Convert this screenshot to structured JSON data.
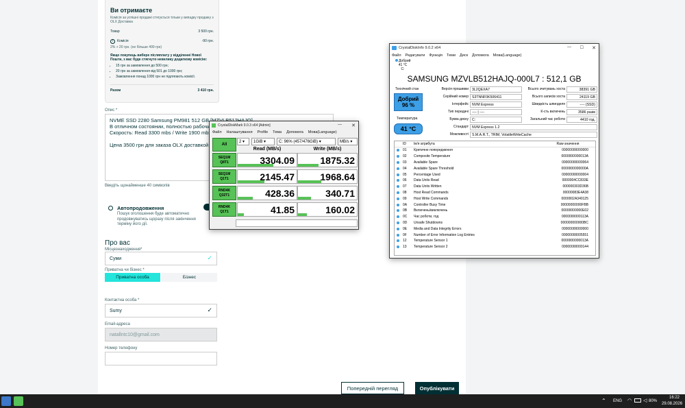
{
  "olx": {
    "card": {
      "title": "Ви отримаєте",
      "note": "Комісія за успішні продажі стягується тільки у випадку продажу з OLX Доставка",
      "goods_label": "Товар",
      "goods_value": "3 500 грн.",
      "commission_label": "Комісія",
      "commission_value": "-90 грн.",
      "commission_sub": "2% + 20 грн. (не більше 499 грн)",
      "extra_note": "Якщо покупець вибере післяплату у відділенні Нової Пошти, з вас буде стягнуто невелику додаткову комісію:",
      "extra_items": [
        "15 грн за замовлення до 500 грн;",
        "20 грн за замовлення від 501 до 1000 грн;",
        "Замовлення понад 1000 грн не підлягають комісії."
      ],
      "total_label": "Разом",
      "total_value": "3 410 грн."
    },
    "description_label": "Опис *",
    "description_text": "NVME SSD  2280 Samsung PM981 512 GB [MZVLB512HAJQ]\nВ отличном состоянии, полностью рабочий, здо...\nСкорость: Read 3300 mbs / Write 1900 mbs\n\nЦена 3500 грн для заказа OLX доставкой, без т...",
    "description_hint": "Введіть щонайменше 40 символів",
    "autorenew_title": "Автопродовження",
    "autorenew_text": "Пошук оголошення буде автоматично продовжуватись щоразу після закінчення терміну його дії.",
    "about_title": "Про вас",
    "location_label": "Місцезнаходження*",
    "location_value": "Суми",
    "person_type_label": "Приватна чи бізнес *",
    "private_label": "Приватна особа",
    "business_label": "Бізнес",
    "contact_label": "Контактна особа *",
    "contact_value": "Sumy",
    "email_label": "Email-адреса",
    "email_value": "natallntc10@gmail.com",
    "phone_label": "Номер телефону",
    "preview_button": "Попередній перегляд",
    "publish_button": "Опублікувати"
  },
  "cdm": {
    "title": "CrystalDiskMark 9.0.3 x64 [Admin]",
    "menu": [
      "Файл",
      "Налаштування",
      "Profile",
      "Тема",
      "Допомога",
      "Мова(Language)"
    ],
    "all_label": "All",
    "count": "2",
    "size": "1GiB",
    "drive": "C: 96% (457/476GiB)",
    "unit": "MB/s",
    "read_header": "Read (MB/s)",
    "write_header": "Write (MB/s)",
    "rows": [
      {
        "l1": "SEQ1M",
        "l2": "Q8T1",
        "read": "3304.09",
        "write": "1875.32",
        "rf": 0.6,
        "wf": 0.35
      },
      {
        "l1": "SEQ1M",
        "l2": "Q1T1",
        "read": "2145.47",
        "write": "1968.64",
        "rf": 0.45,
        "wf": 0.4
      },
      {
        "l1": "RND4K",
        "l2": "Q32T1",
        "read": "428.36",
        "write": "340.71",
        "rf": 0.25,
        "wf": 0.22
      },
      {
        "l1": "RND4K",
        "l2": "Q1T1",
        "read": "41.85",
        "write": "160.02",
        "rf": 0.1,
        "wf": 0.15
      }
    ],
    "accent": "#57c257"
  },
  "cdi": {
    "title": "CrystalDiskInfo 9.0.2 x64",
    "menu": [
      "Файл",
      "Редагувати",
      "Функція",
      "Теми",
      "Диск",
      "Допомога",
      "Мова(Language)"
    ],
    "drive_status": "Добрий",
    "drive_temp": "41 °C",
    "drive_letter": "C:",
    "model": "SAMSUNG MZVLB512HAJQ-000L7 : 512,1 GB",
    "tech_label": "Технічний стан",
    "health": "Добрий",
    "health_pct": "96 %",
    "temp_label": "Температура",
    "temp": "41 °C",
    "fields_left": [
      {
        "k": "Версія прошивки",
        "v": "3L2QEXA7"
      },
      {
        "k": "Серійний номер",
        "v": "S3TNNF0K506411"
      },
      {
        "k": "Інтерфейс",
        "v": "NVM Express"
      },
      {
        "k": "Тип передачі",
        "v": "---- | ----"
      },
      {
        "k": "Буква диску",
        "v": "C:"
      },
      {
        "k": "Стандарт",
        "v": "NVM Express 1.2"
      },
      {
        "k": "Можливості",
        "v": "S.M.A.R.T., TRIM, VolatileWriteCache"
      }
    ],
    "fields_right": [
      {
        "k": "Всього зчитувань хоста",
        "v": "38391 GB"
      },
      {
        "k": "Всього записів хоста",
        "v": "24119 GB"
      },
      {
        "k": "Швидкість шпинделя",
        "v": "---- (SSD)"
      },
      {
        "k": "К-сть включень",
        "v": "3586 разів"
      },
      {
        "k": "Загальний час роботи",
        "v": "4410 год."
      }
    ],
    "table_headers": [
      "ID",
      "Ім'я атрибута",
      "Raw-значення"
    ],
    "attrs": [
      {
        "id": "01",
        "name": "Критичне попередження",
        "raw": "00000000000000"
      },
      {
        "id": "02",
        "name": "Composite Temperature",
        "raw": "0000000000013A"
      },
      {
        "id": "03",
        "name": "Available Spare",
        "raw": "00000000000064"
      },
      {
        "id": "04",
        "name": "Available Spare Threshold",
        "raw": "0000000000000A"
      },
      {
        "id": "05",
        "name": "Percentage Used",
        "raw": "00000000000004"
      },
      {
        "id": "06",
        "name": "Data Units Read",
        "raw": "0000004CC833E"
      },
      {
        "id": "07",
        "name": "Data Units Written",
        "raw": "000000303D36B"
      },
      {
        "id": "08",
        "name": "Host Read Commands",
        "raw": "00000083E4A38"
      },
      {
        "id": "09",
        "name": "Host Write Commands",
        "raw": "0000002A340125"
      },
      {
        "id": "0A",
        "name": "Controller Busy Time",
        "raw": "00000000000FBB"
      },
      {
        "id": "0B",
        "name": "Включень/виключень",
        "raw": "00000000000E02"
      },
      {
        "id": "0C",
        "name": "Час роботи, год",
        "raw": "0000000000113A"
      },
      {
        "id": "0D",
        "name": "Unsafe Shutdowns",
        "raw": "000000000000BC"
      },
      {
        "id": "0E",
        "name": "Media and Data Integrity Errors",
        "raw": "00000000000000"
      },
      {
        "id": "0F",
        "name": "Number of Error Information Log Entries",
        "raw": "00000000005551"
      },
      {
        "id": "12",
        "name": "Temperature Sensor 1",
        "raw": "0000000000013A"
      },
      {
        "id": "13",
        "name": "Temperature Sensor 2",
        "raw": "00000000000144"
      }
    ],
    "accent": "#3d9fe6"
  },
  "taskbar": {
    "lang": "ENG",
    "battery": "80%",
    "time": "16:22",
    "date": "29.08.2026"
  }
}
